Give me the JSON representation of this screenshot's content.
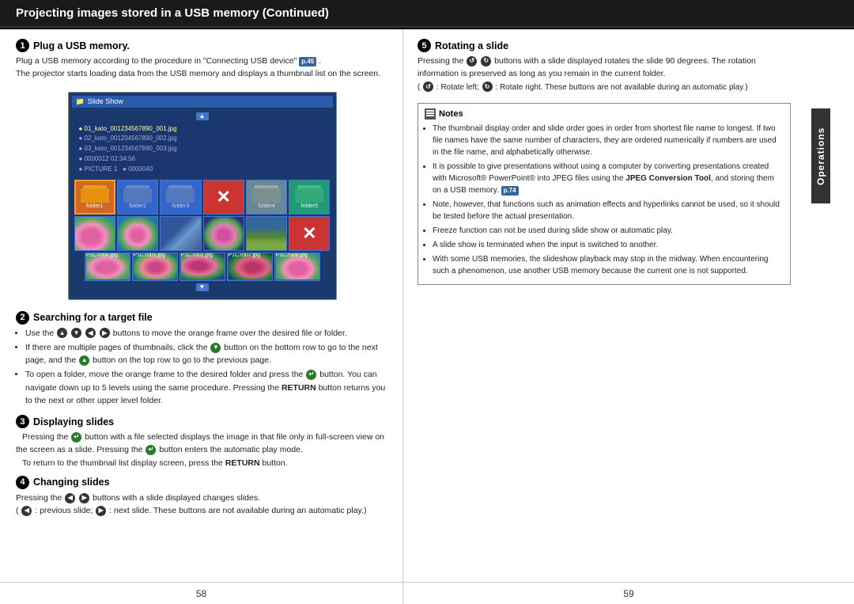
{
  "header": {
    "title": "Projecting images stored in a USB memory (Continued)"
  },
  "left": {
    "section1": {
      "num": "1",
      "title": "Plug a USB memory.",
      "body1": "Plug a USB memory according to the procedure in \"Connecting USB device\"",
      "ref1": "p.45",
      "body2": "The projector starts loading data from the USB memory and displays a thumbnail list on the screen."
    },
    "section2": {
      "num": "2",
      "title": "Searching for a target file",
      "bullet1": "Use the",
      "bullet1b": "buttons to move the orange frame over the desired file or folder.",
      "bullet2": "If there are multiple pages of thumbnails, click the",
      "bullet2b": "button on the bottom row to go to the next page, and the",
      "bullet2c": "button on the top row to go to the previous page.",
      "bullet3": "To open a folder, move the orange frame to the desired folder and press the",
      "bullet3b": "button. You can navigate down up to 5 levels using the same procedure. Pressing the",
      "bullet3c": "RETURN",
      "bullet3d": "button returns you to the next or other upper level folder."
    },
    "section3": {
      "num": "3",
      "title": "Displaying slides",
      "body1": "Pressing the",
      "body1b": "button with a file selected displays the image in that file only in full-screen view on the screen as a slide. Pressing the",
      "body1c": "button enters the automatic play mode.",
      "body2": "To return to the thumbnail list display screen, press the",
      "body2b": "RETURN",
      "body2c": "button."
    },
    "section4": {
      "num": "4",
      "title": "Changing slides",
      "body1": "Pressing the",
      "body1b": "buttons with a slide displayed changes slides.",
      "body2": ": previous slide;",
      "body2b": ": next slide. These buttons are not available during an automatic play.)"
    }
  },
  "right": {
    "section5": {
      "num": "5",
      "title": "Rotating a slide",
      "body1": "Pressing the",
      "body1b": "buttons with a slide displayed rotates the slide 90 degrees. The rotation information is preserved as long as you remain in the current folder.",
      "body2": ": Rotate left;",
      "body2b": ": Rotate right. These buttons are not available during an automatic play.)"
    },
    "notes": {
      "title": "Notes",
      "items": [
        "The thumbnail display order and slide order goes in order from shortest file name to longest. If two file names have the same number of characters, they are ordered numerically if numbers are used in the file name, and alphabetically otherwise.",
        "It is possible to give presentations without using a computer by converting presentations created with Microsoft® PowerPoint® into JPEG files using the JPEG Conversion Tool, and storing them on a USB memory.",
        "Note, however, that functions such as animation effects and hyperlinks cannot be used, so it should be tested before the actual presentation.",
        "Freeze function can not be used during slide show or automatic play.",
        "A slide show is terminated when the input is switched to another.",
        "With some USB memories, the slideshow playback may stop in the midway. When encountering such a phenomenon, use another USB memory because the current one is not supported."
      ],
      "ref_b74": "p.74"
    },
    "sidebar": "Operations"
  },
  "footer": {
    "page_left": "58",
    "page_right": "59"
  }
}
